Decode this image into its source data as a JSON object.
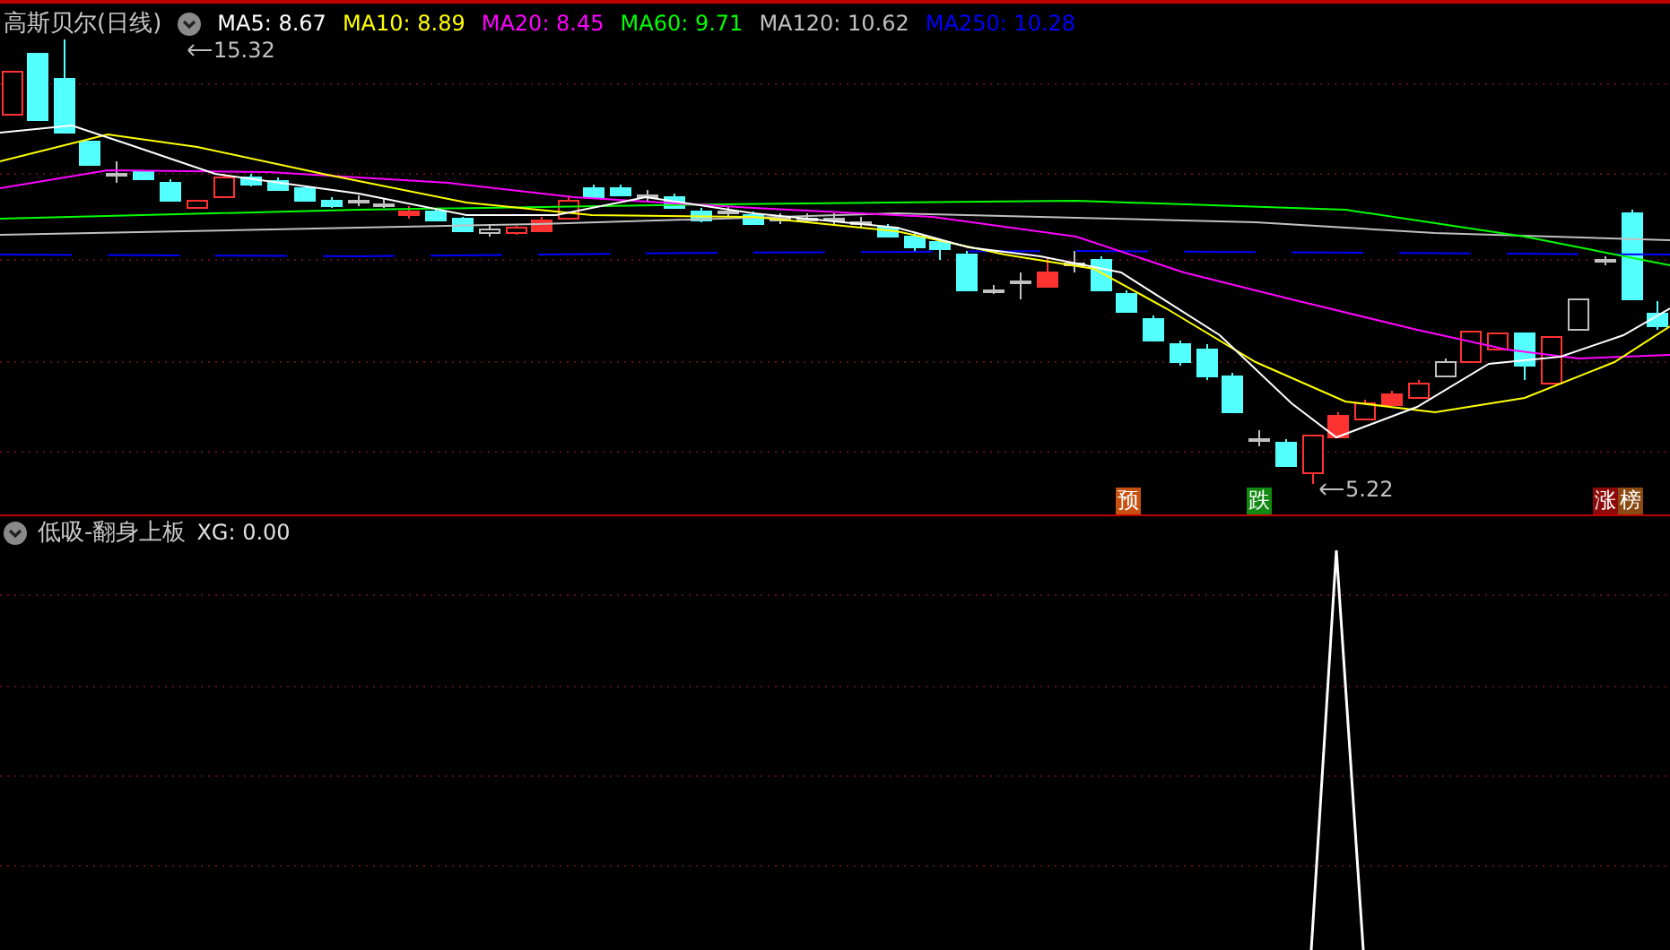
{
  "header": {
    "title": "高斯贝尔(日线)",
    "indicators": [
      {
        "label": "MA5: 8.67",
        "color": "#ffffff"
      },
      {
        "label": "MA10: 8.89",
        "color": "#ffff00"
      },
      {
        "label": "MA20: 8.45",
        "color": "#ff00ff"
      },
      {
        "label": "MA60: 9.71",
        "color": "#00ff00"
      },
      {
        "label": "MA120: 10.62",
        "color": "#c0c0c0"
      },
      {
        "label": "MA250: 10.28",
        "color": "#0000ff"
      }
    ]
  },
  "price_labels": [
    {
      "text": "15.32"
    },
    {
      "text": "5.22"
    }
  ],
  "signals": [
    {
      "text": "预",
      "color": "#c8500f"
    },
    {
      "text": "跌",
      "color": "#128a12"
    },
    {
      "text": "涨",
      "color": "#8c0a0a"
    },
    {
      "text": "榜",
      "color": "#8a4a12"
    }
  ],
  "indicator_panel": {
    "title": "低吸-翻身上板",
    "reading": "XG: 0.00"
  }
}
